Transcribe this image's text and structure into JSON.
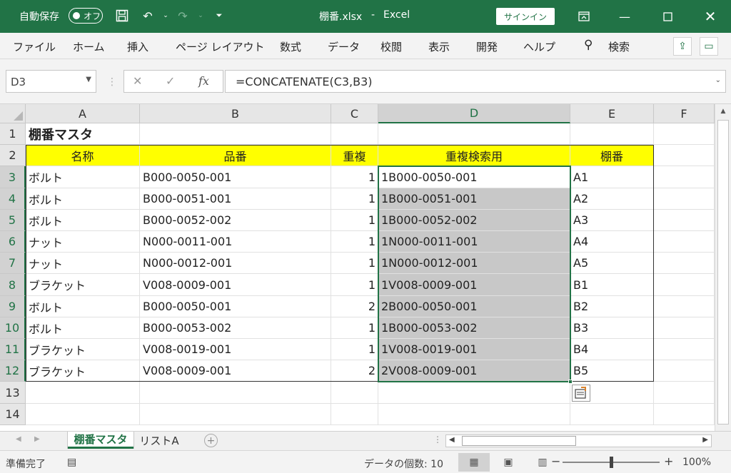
{
  "titlebar": {
    "autosave_label": "自動保存",
    "autosave_state": "オフ",
    "filename": "棚番.xlsx",
    "separator": "-",
    "app": "Excel",
    "signin": "サインイン",
    "icons": [
      "save-icon",
      "undo-icon",
      "redo-icon",
      "customize-icon",
      "ribbon-display-icon",
      "minimize-icon",
      "maximize-icon",
      "close-icon"
    ]
  },
  "ribbon": {
    "tabs": [
      "ファイル",
      "ホーム",
      "挿入",
      "ページ レイアウト",
      "数式",
      "データ",
      "校閲",
      "表示",
      "開発",
      "ヘルプ"
    ],
    "search": "検索"
  },
  "formula_bar": {
    "name_box": "D3",
    "formula": "=CONCATENATE(C3,B3)",
    "fx": "fx"
  },
  "grid": {
    "columns": [
      "A",
      "B",
      "C",
      "D",
      "E",
      "F"
    ],
    "selected_column": "D",
    "rows": [
      "1",
      "2",
      "3",
      "4",
      "5",
      "6",
      "7",
      "8",
      "9",
      "10",
      "11",
      "12",
      "13",
      "14"
    ],
    "title": "棚番マスタ",
    "headers": [
      "名称",
      "品番",
      "重複",
      "重複検索用",
      "棚番"
    ],
    "data": [
      [
        "ボルト",
        "B000-0050-001",
        "1",
        "1B000-0050-001",
        "A1"
      ],
      [
        "ボルト",
        "B000-0051-001",
        "1",
        "1B000-0051-001",
        "A2"
      ],
      [
        "ボルト",
        "B000-0052-002",
        "1",
        "1B000-0052-002",
        "A3"
      ],
      [
        "ナット",
        "N000-0011-001",
        "1",
        "1N000-0011-001",
        "A4"
      ],
      [
        "ナット",
        "N000-0012-001",
        "1",
        "1N000-0012-001",
        "A5"
      ],
      [
        "ブラケット",
        "V008-0009-001",
        "1",
        "1V008-0009-001",
        "B1"
      ],
      [
        "ボルト",
        "B000-0050-001",
        "2",
        "2B000-0050-001",
        "B2"
      ],
      [
        "ボルト",
        "B000-0053-002",
        "1",
        "1B000-0053-002",
        "B3"
      ],
      [
        "ブラケット",
        "V008-0019-001",
        "1",
        "1V008-0019-001",
        "B4"
      ],
      [
        "ブラケット",
        "V008-0009-001",
        "2",
        "2V008-0009-001",
        "B5"
      ]
    ]
  },
  "sheets": {
    "tabs": [
      "棚番マスタ",
      "リストA"
    ],
    "active": "棚番マスタ"
  },
  "statusbar": {
    "ready": "準備完了",
    "count_label": "データの個数: 10",
    "zoom": "100%",
    "zoom_fraction": 0.5
  },
  "colors": {
    "accent": "#217346",
    "header_fill": "#ffff00",
    "selection_fill": "#c8c8c8"
  }
}
